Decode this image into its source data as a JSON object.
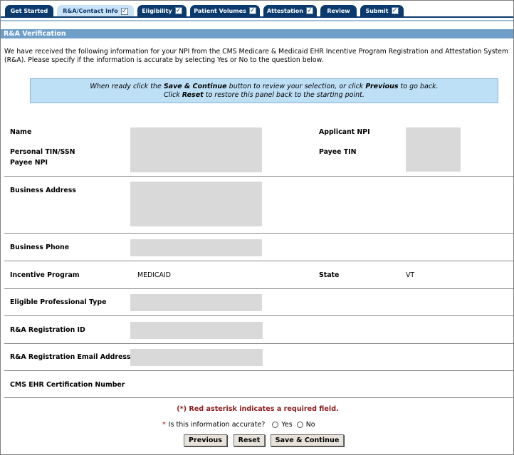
{
  "tabs": [
    {
      "label": "Get Started",
      "checked": false
    },
    {
      "label": "R&A/Contact Info",
      "checked": true
    },
    {
      "label": "Eligibility",
      "checked": true
    },
    {
      "label": "Patient Volumes",
      "checked": true
    },
    {
      "label": "Attestation",
      "checked": true
    },
    {
      "label": "Review",
      "checked": false
    },
    {
      "label": "Submit",
      "checked": true
    }
  ],
  "check_glyph": "✓",
  "section_title": "R&A Verification",
  "intro_text": "We have received the following information for your NPI from the CMS Medicare & Medicaid EHR Incentive Program Registration and Attestation System (R&A). Please specify if the information is accurate by selecting Yes or No to the question below.",
  "instructions": {
    "line1_pre": "When ready click the ",
    "line1_b1": "Save & Continue",
    "line1_mid": " button to review your selection, or click ",
    "line1_b2": "Previous",
    "line1_post": " to go back.",
    "line2_pre": "Click ",
    "line2_b": "Reset",
    "line2_post": " to restore this panel back to the starting point."
  },
  "fields": {
    "name": "Name",
    "personal_tin": "Personal TIN/SSN",
    "payee_npi": "Payee NPI",
    "applicant_npi": "Applicant NPI",
    "payee_tin": "Payee TIN",
    "business_address": "Business Address",
    "business_phone": "Business Phone",
    "incentive_program": "Incentive Program",
    "incentive_program_value": "MEDICAID",
    "state": "State",
    "state_value": "VT",
    "eligible_professional_type": "Eligible Professional Type",
    "registration_id": "R&A Registration ID",
    "registration_email": "R&A Registration Email Address",
    "cms_ehr_cert": "CMS EHR Certification Number"
  },
  "required_note": "(*) Red asterisk indicates a required field.",
  "question": {
    "asterisk": "*",
    "text": "Is this information accurate?",
    "yes": "Yes",
    "no": "No"
  },
  "buttons": {
    "previous": "Previous",
    "reset": "Reset",
    "save_continue": "Save & Continue"
  }
}
